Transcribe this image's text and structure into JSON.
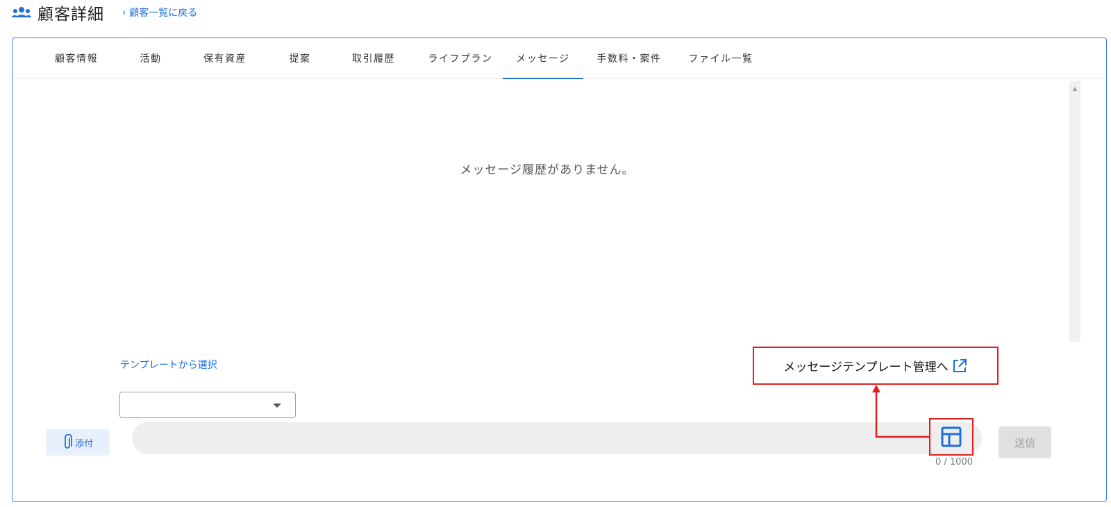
{
  "header": {
    "title": "顧客詳細",
    "back_link": "顧客一覧に戻る",
    "icon": "users-icon"
  },
  "tabs": [
    {
      "label": "顧客情報"
    },
    {
      "label": "活動"
    },
    {
      "label": "保有資産"
    },
    {
      "label": "提案"
    },
    {
      "label": "取引履歴"
    },
    {
      "label": "ライフプラン"
    },
    {
      "label": "メッセージ",
      "active": true
    },
    {
      "label": "手数料・案件"
    },
    {
      "label": "ファイル一覧"
    }
  ],
  "messages": {
    "empty_text": "メッセージ履歴がありません。"
  },
  "composer": {
    "template_link": "テンプレートから選択",
    "template_select_value": "",
    "attach_label": "添付",
    "input_value": "",
    "char_count": "0 / 1000",
    "send_label": "送信"
  },
  "callout": {
    "label": "メッセージテンプレート管理へ",
    "icon": "external-link-icon",
    "highlight_color": "#e02020"
  },
  "colors": {
    "accent": "#1d6fe0",
    "card_border": "#3b82f6",
    "annotation": "#e02020"
  }
}
